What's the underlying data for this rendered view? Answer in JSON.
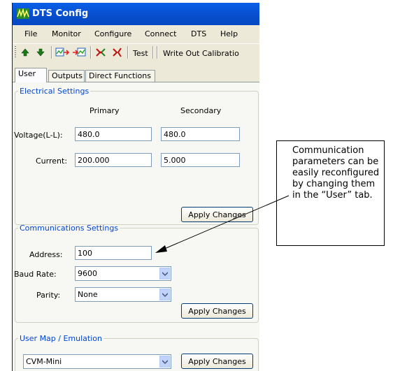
{
  "window": {
    "title": "DTS Config"
  },
  "menu": [
    "File",
    "Monitor",
    "Configure",
    "Connect",
    "DTS",
    "Help"
  ],
  "toolbar": {
    "test_label": "Test",
    "write_label": "Write Out Calibratio"
  },
  "tabs": [
    "User",
    "Outputs",
    "Direct Functions"
  ],
  "electrical": {
    "legend": "Electrical Settings",
    "col_primary": "Primary",
    "col_secondary": "Secondary",
    "voltage_label": "Voltage(L-L):",
    "voltage_primary": "480.0",
    "voltage_secondary": "480.0",
    "current_label": "Current:",
    "current_primary": "200.000",
    "current_secondary": "5.000",
    "apply_label": "Apply Changes"
  },
  "communications": {
    "legend": "Communications Settings",
    "address_label": "Address:",
    "address_value": "100",
    "baud_label": "Baud Rate:",
    "baud_value": "9600",
    "parity_label": "Parity:",
    "parity_value": "None",
    "apply_label": "Apply Changes"
  },
  "usermap": {
    "legend": "User Map / Emulation",
    "value": "CVM-Mini",
    "apply_label": "Apply Changes"
  },
  "callout": {
    "text": "Communication parameters can be easily reconfigured by changing them in the “User” tab."
  },
  "colors": {
    "titlebar": "#0a5fe8",
    "legend": "#0046d5",
    "window_bg": "#ece9d8"
  },
  "icons": [
    "app-icon",
    "arrow-up-icon",
    "arrow-down-icon",
    "read-icon",
    "write-icon",
    "connect-icon",
    "disconnect-icon",
    "dropdown-arrow-icon"
  ]
}
